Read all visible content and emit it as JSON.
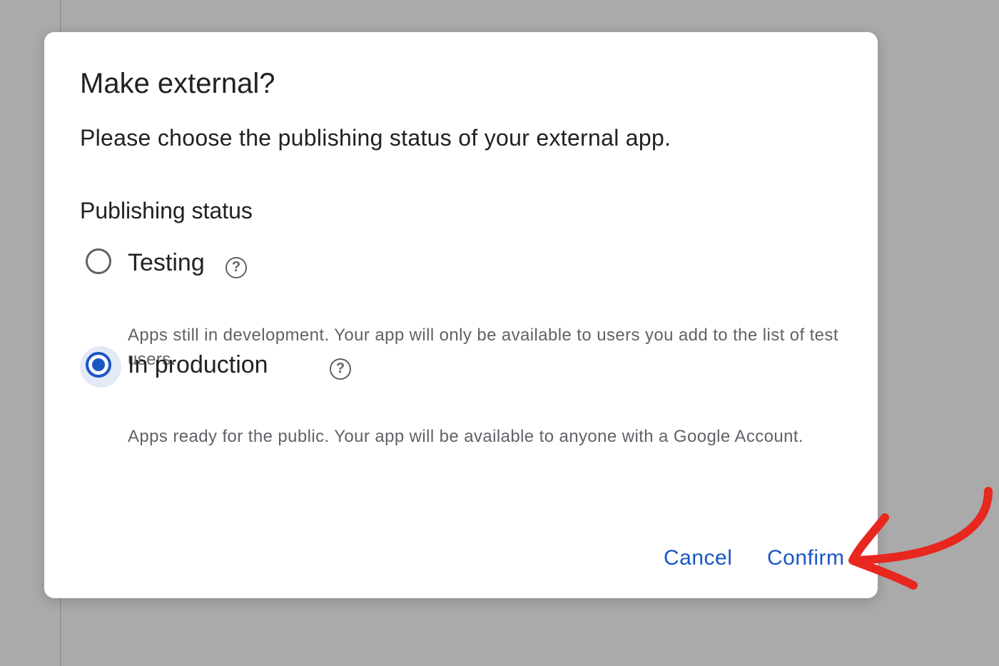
{
  "dialog": {
    "title": "Make external?",
    "subtitle": "Please choose the publishing status of your external app.",
    "section_label": "Publishing status",
    "options": [
      {
        "label": "Testing",
        "description": "Apps still in development. Your app will only be available to users you add to the list of test users.",
        "selected": false,
        "help_icon": "help-circle-icon"
      },
      {
        "label": "In production",
        "description": "Apps ready for the public. Your app will be available to anyone with a Google Account.",
        "selected": true,
        "help_icon": "help-circle-icon"
      }
    ],
    "buttons": {
      "cancel": "Cancel",
      "confirm": "Confirm"
    }
  },
  "colors": {
    "backdrop": "#aaaaaa",
    "accent": "#1a56c4",
    "annotation": "#e8271f",
    "text_primary": "#202124",
    "text_secondary": "#5f6368"
  },
  "annotation": {
    "icon": "red-arrow-icon",
    "target": "confirm-button"
  }
}
